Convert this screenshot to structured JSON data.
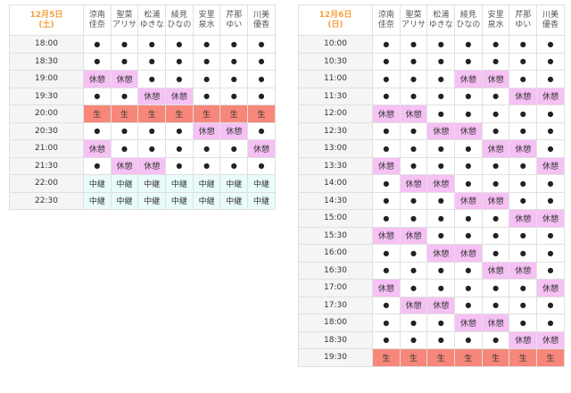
{
  "colors": {
    "rest": "#f6c1f4",
    "live": "#f7877a",
    "relay": "#e9fbfb",
    "date": "#f5a03c"
  },
  "members": [
    [
      "涼南",
      "佳奈"
    ],
    [
      "聖菜",
      "アリサ"
    ],
    [
      "松浦",
      "ゆきな"
    ],
    [
      "綾見",
      "ひなの"
    ],
    [
      "安里",
      "泉水"
    ],
    [
      "芹那",
      "ゆい"
    ],
    [
      "川美",
      "優香"
    ]
  ],
  "legend": {
    "dot": "●",
    "rest": "休憩",
    "live": "生",
    "relay": "中継"
  },
  "saturday": {
    "date": "12月5日",
    "weekday": "(土)",
    "rows": [
      {
        "time": "18:00",
        "cells": [
          "dot",
          "dot",
          "dot",
          "dot",
          "dot",
          "dot",
          "dot"
        ]
      },
      {
        "time": "18:30",
        "cells": [
          "dot",
          "dot",
          "dot",
          "dot",
          "dot",
          "dot",
          "dot"
        ]
      },
      {
        "time": "19:00",
        "cells": [
          "rest",
          "rest",
          "dot",
          "dot",
          "dot",
          "dot",
          "dot"
        ]
      },
      {
        "time": "19:30",
        "cells": [
          "dot",
          "dot",
          "rest",
          "rest",
          "dot",
          "dot",
          "dot"
        ]
      },
      {
        "time": "20:00",
        "cells": [
          "live",
          "live",
          "live",
          "live",
          "live",
          "live",
          "live"
        ]
      },
      {
        "time": "20:30",
        "cells": [
          "dot",
          "dot",
          "dot",
          "dot",
          "rest",
          "rest",
          "dot"
        ]
      },
      {
        "time": "21:00",
        "cells": [
          "rest",
          "dot",
          "dot",
          "dot",
          "dot",
          "dot",
          "rest"
        ]
      },
      {
        "time": "21:30",
        "cells": [
          "dot",
          "rest",
          "rest",
          "dot",
          "dot",
          "dot",
          "dot"
        ]
      },
      {
        "time": "22:00",
        "cells": [
          "relay",
          "relay",
          "relay",
          "relay",
          "relay",
          "relay",
          "relay"
        ]
      },
      {
        "time": "22:30",
        "cells": [
          "relay",
          "relay",
          "relay",
          "relay",
          "relay",
          "relay",
          "relay"
        ]
      }
    ]
  },
  "sunday": {
    "date": "12月6日",
    "weekday": "(日)",
    "rows": [
      {
        "time": "10:00",
        "cells": [
          "dot",
          "dot",
          "dot",
          "dot",
          "dot",
          "dot",
          "dot"
        ]
      },
      {
        "time": "10:30",
        "cells": [
          "dot",
          "dot",
          "dot",
          "dot",
          "dot",
          "dot",
          "dot"
        ]
      },
      {
        "time": "11:00",
        "cells": [
          "dot",
          "dot",
          "dot",
          "rest",
          "rest",
          "dot",
          "dot"
        ]
      },
      {
        "time": "11:30",
        "cells": [
          "dot",
          "dot",
          "dot",
          "dot",
          "dot",
          "rest",
          "rest"
        ]
      },
      {
        "time": "12:00",
        "cells": [
          "rest",
          "rest",
          "dot",
          "dot",
          "dot",
          "dot",
          "dot"
        ]
      },
      {
        "time": "12:30",
        "cells": [
          "dot",
          "dot",
          "rest",
          "rest",
          "dot",
          "dot",
          "dot"
        ]
      },
      {
        "time": "13:00",
        "cells": [
          "dot",
          "dot",
          "dot",
          "dot",
          "rest",
          "rest",
          "dot"
        ]
      },
      {
        "time": "13:30",
        "cells": [
          "rest",
          "dot",
          "dot",
          "dot",
          "dot",
          "dot",
          "rest"
        ]
      },
      {
        "time": "14:00",
        "cells": [
          "dot",
          "rest",
          "rest",
          "dot",
          "dot",
          "dot",
          "dot"
        ]
      },
      {
        "time": "14:30",
        "cells": [
          "dot",
          "dot",
          "dot",
          "rest",
          "rest",
          "dot",
          "dot"
        ]
      },
      {
        "time": "15:00",
        "cells": [
          "dot",
          "dot",
          "dot",
          "dot",
          "dot",
          "rest",
          "rest"
        ]
      },
      {
        "time": "15:30",
        "cells": [
          "rest",
          "rest",
          "dot",
          "dot",
          "dot",
          "dot",
          "dot"
        ]
      },
      {
        "time": "16:00",
        "cells": [
          "dot",
          "dot",
          "rest",
          "rest",
          "dot",
          "dot",
          "dot"
        ]
      },
      {
        "time": "16:30",
        "cells": [
          "dot",
          "dot",
          "dot",
          "dot",
          "rest",
          "rest",
          "dot"
        ]
      },
      {
        "time": "17:00",
        "cells": [
          "rest",
          "dot",
          "dot",
          "dot",
          "dot",
          "dot",
          "rest"
        ]
      },
      {
        "time": "17:30",
        "cells": [
          "dot",
          "rest",
          "rest",
          "dot",
          "dot",
          "dot",
          "dot"
        ]
      },
      {
        "time": "18:00",
        "cells": [
          "dot",
          "dot",
          "dot",
          "rest",
          "rest",
          "dot",
          "dot"
        ]
      },
      {
        "time": "18:30",
        "cells": [
          "dot",
          "dot",
          "dot",
          "dot",
          "dot",
          "rest",
          "rest"
        ]
      },
      {
        "time": "19:30",
        "cells": [
          "live",
          "live",
          "live",
          "live",
          "live",
          "live",
          "live"
        ]
      }
    ]
  }
}
